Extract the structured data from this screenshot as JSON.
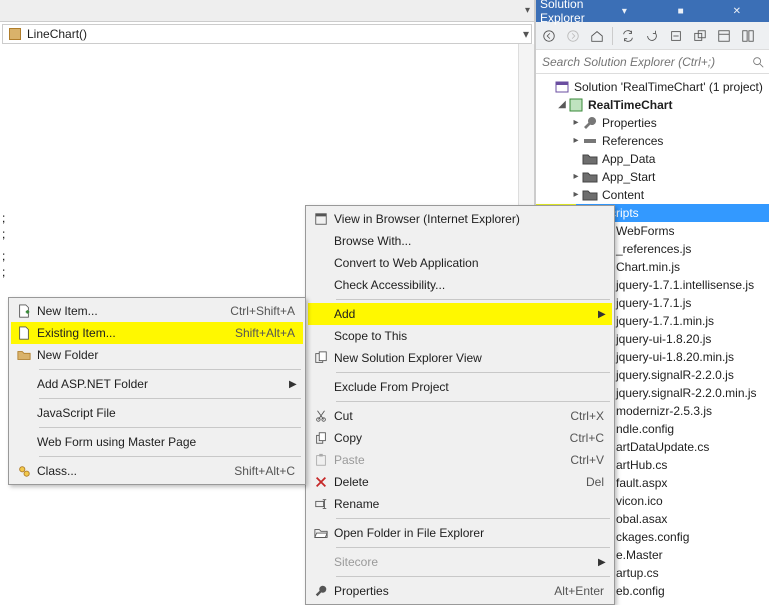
{
  "editor": {
    "dropdown": "LineChart()"
  },
  "code_gutter": [
    ";",
    ";",
    ";",
    ";"
  ],
  "solution_explorer": {
    "title": "Solution Explorer",
    "search_placeholder": "Search Solution Explorer (Ctrl+;)",
    "solution_line": "Solution 'RealTimeChart' (1 project)",
    "project": "RealTimeChart",
    "nodes": {
      "properties": "Properties",
      "references": "References",
      "app_data": "App_Data",
      "app_start": "App_Start",
      "content": "Content",
      "scripts": "Scripts"
    },
    "script_children": [
      "WebForms",
      "_references.js",
      "Chart.min.js",
      "jquery-1.7.1.intellisense.js",
      "jquery-1.7.1.js",
      "jquery-1.7.1.min.js",
      "jquery-ui-1.8.20.js",
      "jquery-ui-1.8.20.min.js",
      "jquery.signalR-2.2.0.js",
      "jquery.signalR-2.2.0.min.js",
      "modernizr-2.5.3.js"
    ],
    "tail_files": [
      "ndle.config",
      "artDataUpdate.cs",
      "artHub.cs",
      "fault.aspx",
      "vicon.ico",
      "obal.asax",
      "ckages.config",
      "e.Master",
      "artup.cs",
      "eb.config"
    ]
  },
  "context_menu_main": {
    "items": [
      {
        "label": "View in Browser (Internet Explorer)",
        "icon": "browser-icon"
      },
      {
        "label": "Browse With..."
      },
      {
        "label": "Convert to Web Application"
      },
      {
        "label": "Check Accessibility..."
      },
      {
        "sep": true
      },
      {
        "label": "Add",
        "submenu": true,
        "highlight": true
      },
      {
        "label": "Scope to This"
      },
      {
        "label": "New Solution Explorer View",
        "icon": "new-view-icon"
      },
      {
        "sep": true
      },
      {
        "label": "Exclude From Project"
      },
      {
        "sep": true
      },
      {
        "label": "Cut",
        "icon": "cut-icon",
        "shortcut": "Ctrl+X"
      },
      {
        "label": "Copy",
        "icon": "copy-icon",
        "shortcut": "Ctrl+C"
      },
      {
        "label": "Paste",
        "icon": "paste-icon",
        "shortcut": "Ctrl+V",
        "disabled": true
      },
      {
        "label": "Delete",
        "icon": "delete-icon",
        "shortcut": "Del"
      },
      {
        "label": "Rename",
        "icon": "rename-icon"
      },
      {
        "sep": true
      },
      {
        "label": "Open Folder in File Explorer",
        "icon": "open-folder-icon"
      },
      {
        "sep": true
      },
      {
        "label": "Sitecore",
        "submenu": true,
        "disabled": true
      },
      {
        "sep": true
      },
      {
        "label": "Properties",
        "icon": "properties-icon",
        "shortcut": "Alt+Enter"
      }
    ]
  },
  "context_menu_add": {
    "items": [
      {
        "label": "New Item...",
        "icon": "new-item-icon",
        "shortcut": "Ctrl+Shift+A"
      },
      {
        "label": "Existing Item...",
        "icon": "existing-item-icon",
        "shortcut": "Shift+Alt+A",
        "highlight": true
      },
      {
        "label": "New Folder",
        "icon": "new-folder-icon"
      },
      {
        "sep": true
      },
      {
        "label": "Add ASP.NET Folder",
        "submenu": true
      },
      {
        "sep": true
      },
      {
        "label": "JavaScript File"
      },
      {
        "sep": true
      },
      {
        "label": "Web Form using Master Page"
      },
      {
        "sep": true
      },
      {
        "label": "Class...",
        "icon": "class-icon",
        "shortcut": "Shift+Alt+C"
      }
    ]
  }
}
